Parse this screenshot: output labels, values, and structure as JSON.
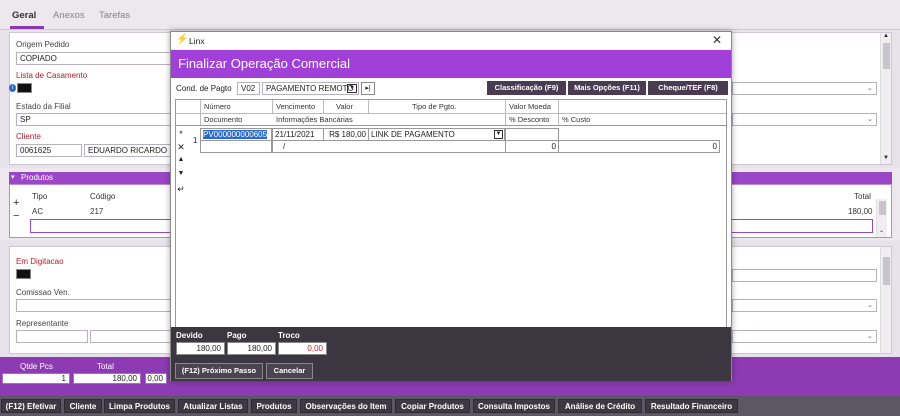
{
  "tabs": [
    "Geral",
    "Anexos",
    "Tarefas"
  ],
  "geral": {
    "origem_label": "Origem Pedido",
    "origem_value": "COPIADO",
    "lista_label": "Lista de Casamento",
    "estado_label": "Estado da Filial",
    "estado_value": "SP",
    "cliente_label": "Cliente",
    "cliente_code": "0061625",
    "cliente_name": "EDUARDO RICARDO"
  },
  "produtos": {
    "title": "Produtos",
    "col_tipo": "Tipo",
    "col_codigo": "Código",
    "col_total": "Total",
    "row_tipo": "AC",
    "row_codigo": "217",
    "row_total": "180,00"
  },
  "status": {
    "em_digitacao_label": "Em Digitacao",
    "comissao_label": "Comissao Ven.",
    "representante_label": "Representante"
  },
  "totals_bar": {
    "qtde_label": "Qtde Pcs",
    "total_label": "Total",
    "qtde_value": "1",
    "total_value": "180,00",
    "extra_value": "0,00"
  },
  "bottom_buttons": [
    "(F12) Efetivar",
    "Cliente",
    "Limpa Produtos",
    "Atualizar Listas",
    "Produtos",
    "Observações do Item",
    "Copiar Produtos",
    "Consulta Impostos",
    "Análise de Crédito",
    "Resultado Financeiro"
  ],
  "dialog": {
    "window_title": "Linx",
    "header": "Finalizar Operação Comercial",
    "cond_label": "Cond. de Pagto",
    "cond_code": "V02",
    "cond_desc": "PAGAMENTO REMOTO",
    "btn_classificacao": "Classificação (F9)",
    "btn_mais_opcoes": "Mais Opções (F11)",
    "btn_cheque": "Cheque/TEF (F8)",
    "grid_headers_1": [
      "Número",
      "Vencimento",
      "Valor",
      "Tipo de Pgto.",
      "Valor Moeda"
    ],
    "grid_headers_2": [
      "Documento",
      "Informações Bancárias",
      "% Desconto",
      "% Custo"
    ],
    "row_number": "1",
    "row_numero": "PV000000000605",
    "row_vencimento": "21/11/2021",
    "row_valor": "R$ 180,00",
    "row_tipo": "LINK DE PAGAMENTO",
    "row_info": "/",
    "row_desconto": "0",
    "row_custo": "0",
    "devido_label": "Devido",
    "pago_label": "Pago",
    "troco_label": "Troco",
    "devido_value": "180,00",
    "pago_value": "180,00",
    "troco_value": "0,00",
    "btn_proximo": "(F12) Próximo Passo",
    "btn_cancelar": "Cancelar"
  },
  "colors": {
    "accent": "#a140d8",
    "troco_red": "#d0202a"
  }
}
